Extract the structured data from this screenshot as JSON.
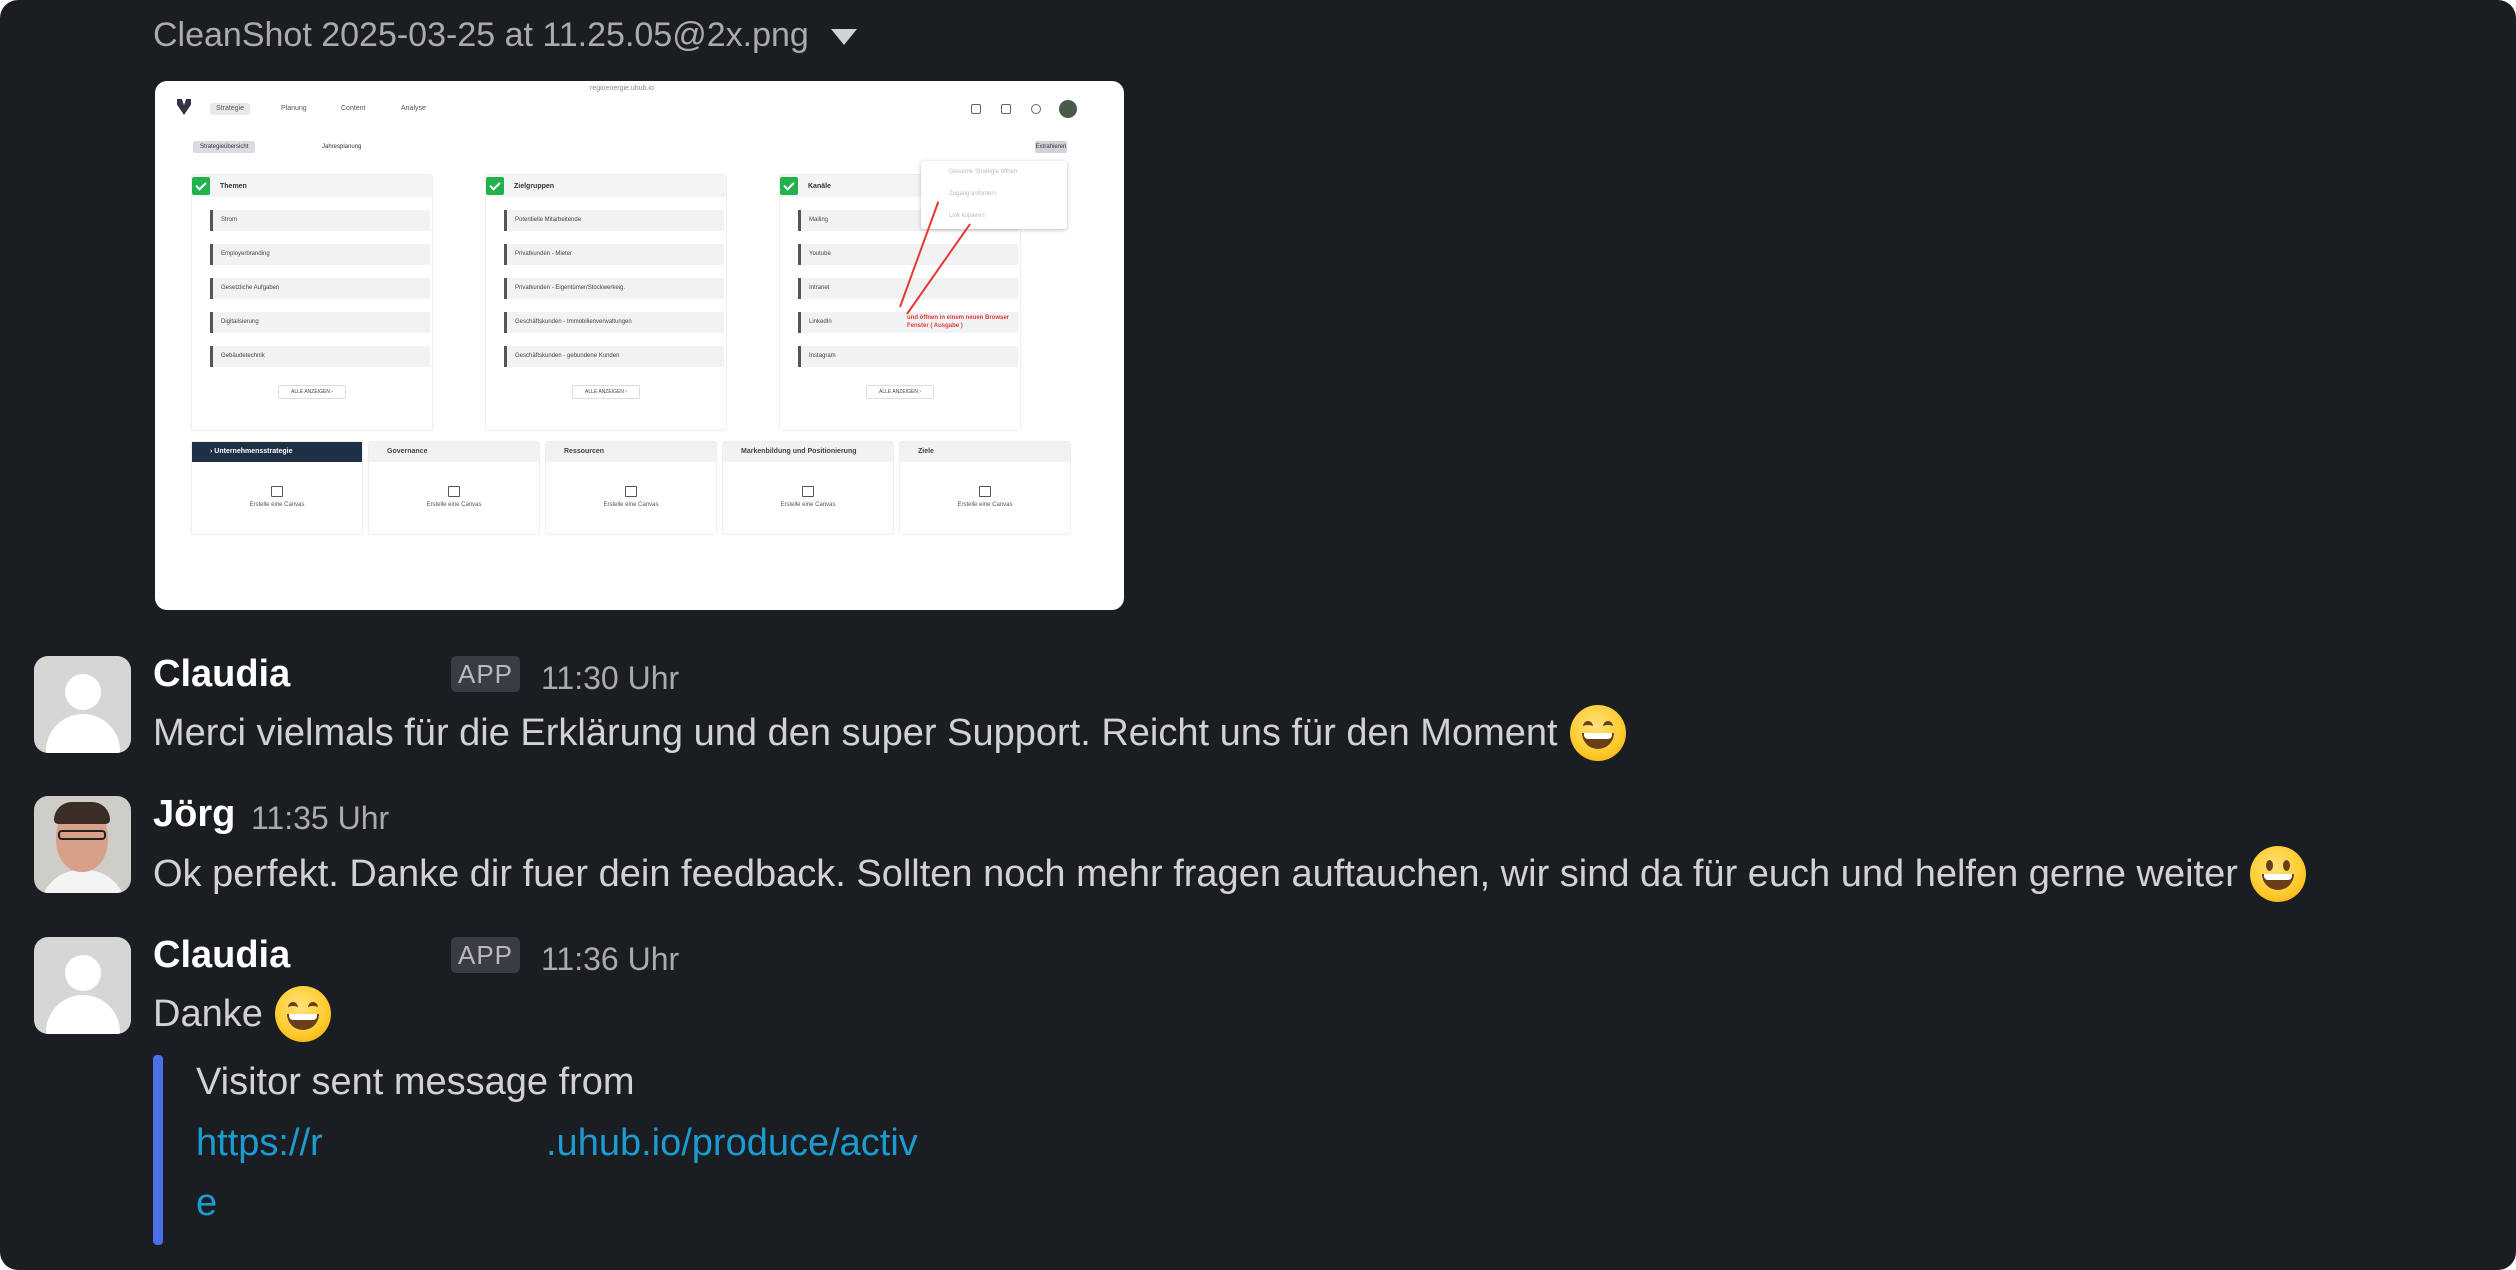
{
  "file": {
    "title": "CleanShot 2025-03-25 at 11.25.05@2x.png"
  },
  "screenshot": {
    "url": "regioenergie.uhub.io",
    "nav_tabs": [
      "Strategie",
      "Planung",
      "Content",
      "Analyse"
    ],
    "sub_tabs": [
      "Strategieübersicht",
      "Jahresplanung"
    ],
    "action_button": "Extrahieren",
    "columns": [
      {
        "title": "Themen",
        "items": [
          "Strom",
          "Employerbranding",
          "Gesetzliche Aufgaben",
          "Digitalisierung",
          "Gebäudetechnik"
        ],
        "more": "ALLE ANZEIGEN  ›"
      },
      {
        "title": "Zielgruppen",
        "items": [
          "Potentielle Mitarbeitende",
          "Privatkunden - Mieter",
          "Privatkunden - Eigentümer/Stockwerkeig.",
          "Geschäftskunden - Immobilienverwaltungen",
          "Geschäftskunden - gebundene Kunden"
        ],
        "more": "ALLE ANZEIGEN  ›"
      },
      {
        "title": "Kanäle",
        "items": [
          "Mailing",
          "Youtube",
          "Intranet",
          "LinkedIn",
          "Instagram"
        ],
        "more": "ALLE ANZEIGEN  ›"
      }
    ],
    "dropdown": [
      "Gesamte Strategie öffnen",
      "Zugang anfordern",
      "Link kopieren"
    ],
    "annotation": "und öffnen in einem neuen Browser Fenster ( Ausgabe )",
    "canvases": [
      {
        "title": "›  Unternehmensstrategie",
        "label": "Erstelle eine Canvas"
      },
      {
        "title": "Governance",
        "label": "Erstelle eine Canvas"
      },
      {
        "title": "Ressourcen",
        "label": "Erstelle eine Canvas"
      },
      {
        "title": "Markenbildung und Positionierung",
        "label": "Erstelle eine Canvas"
      },
      {
        "title": "Ziele",
        "label": "Erstelle eine Canvas"
      }
    ]
  },
  "messages": [
    {
      "author": "Claudia",
      "badge": "APP",
      "time": "11:30 Uhr",
      "text": "Merci vielmals für die Erklärung und den super Support. Reicht uns für den Moment",
      "emoji": "grinning-smiling-eyes"
    },
    {
      "author": "Jörg",
      "time": "11:35 Uhr",
      "text": "Ok perfekt. Danke dir fuer dein feedback. Sollten noch mehr fragen auftauchen, wir sind da für euch und helfen gerne weiter",
      "emoji": "grinning"
    },
    {
      "author": "Claudia",
      "badge": "APP",
      "time": "11:36 Uhr",
      "text": "Danke",
      "emoji": "grinning-smiling-eyes"
    }
  ],
  "attachment": {
    "text": "Visitor sent message from",
    "link_part1": "https://r",
    "link_part2": ".uhub.io/produce/activ",
    "link_part3": "e"
  },
  "colors": {
    "background": "#1a1d21",
    "link": "#1d9bd1",
    "accent_bar": "#4a6fe8"
  }
}
